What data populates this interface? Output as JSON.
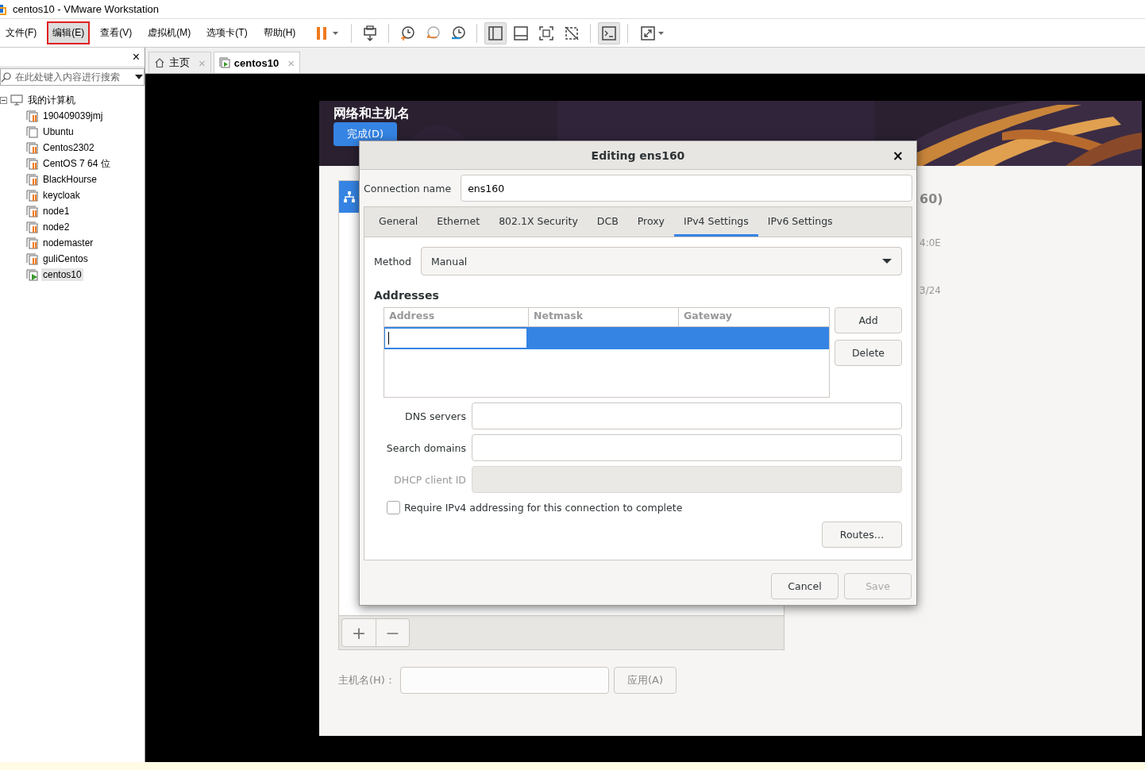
{
  "window": {
    "title": "centos10 - VMware Workstation"
  },
  "menu": [
    {
      "label": "文件(F)",
      "selected": false
    },
    {
      "label": "编辑(E)",
      "selected": true
    },
    {
      "label": "查看(V)",
      "selected": false
    },
    {
      "label": "虚拟机(M)",
      "selected": false
    },
    {
      "label": "选项卡(T)",
      "selected": false
    },
    {
      "label": "帮助(H)",
      "selected": false
    }
  ],
  "toolbar": [
    {
      "kind": "pause",
      "pressed": false
    },
    {
      "kind": "separator"
    },
    {
      "kind": "send-keys",
      "pressed": false
    },
    {
      "kind": "separator"
    },
    {
      "kind": "snapshot-take",
      "pressed": false
    },
    {
      "kind": "snapshot-revert",
      "pressed": false
    },
    {
      "kind": "snapshot-manager",
      "pressed": false
    },
    {
      "kind": "separator"
    },
    {
      "kind": "library-view",
      "pressed": true
    },
    {
      "kind": "thumbnail-bar",
      "pressed": false
    },
    {
      "kind": "full-screen",
      "pressed": false
    },
    {
      "kind": "unity",
      "pressed": false
    },
    {
      "kind": "separator"
    },
    {
      "kind": "console",
      "pressed": true
    },
    {
      "kind": "separator"
    },
    {
      "kind": "stretch",
      "pressed": false
    }
  ],
  "library": {
    "close": "×",
    "search": {
      "placeholder": "在此处键入内容进行搜索"
    },
    "tree": [
      {
        "label": "我的计算机",
        "expanded": true,
        "children": [
          {
            "label": "190409039jmj",
            "suspended": true,
            "running": false,
            "selected": false
          },
          {
            "label": "Ubuntu",
            "suspended": false,
            "running": false,
            "selected": false
          },
          {
            "label": "Centos2302",
            "suspended": true,
            "running": false,
            "selected": false
          },
          {
            "label": "CentOS 7 64 位",
            "suspended": true,
            "running": false,
            "selected": false
          },
          {
            "label": "BlackHourse",
            "suspended": true,
            "running": false,
            "selected": false
          },
          {
            "label": "keycloak",
            "suspended": true,
            "running": false,
            "selected": false
          },
          {
            "label": "node1",
            "suspended": true,
            "running": false,
            "selected": false
          },
          {
            "label": "node2",
            "suspended": true,
            "running": false,
            "selected": false
          },
          {
            "label": "nodemaster",
            "suspended": true,
            "running": false,
            "selected": false
          },
          {
            "label": "guliCentos",
            "suspended": true,
            "running": false,
            "selected": false
          },
          {
            "label": "centos10",
            "suspended": false,
            "running": true,
            "selected": true
          }
        ]
      }
    ]
  },
  "tabs": [
    {
      "label": "主页",
      "kind": "home",
      "selected": false,
      "close": "×"
    },
    {
      "label": "centos10",
      "kind": "vm",
      "selected": true,
      "close": "×"
    }
  ],
  "guest": {
    "title": "网络和主机名",
    "done_button": "完成(D)",
    "device_fragments": [
      "60)",
      "4:0E",
      "3/24"
    ],
    "add_button": "+",
    "remove_button": "−",
    "hostname": {
      "label": "主机名(H)：",
      "apply_button": "应用(A)"
    }
  },
  "dialog": {
    "title": "Editing ens160",
    "close": "×",
    "connection_name": {
      "label": "Connection name",
      "value": "ens160"
    },
    "tabs": [
      {
        "label": "General",
        "selected": false
      },
      {
        "label": "Ethernet",
        "selected": false
      },
      {
        "label": "802.1X Security",
        "selected": false
      },
      {
        "label": "DCB",
        "selected": false
      },
      {
        "label": "Proxy",
        "selected": false
      },
      {
        "label": "IPv4 Settings",
        "selected": true
      },
      {
        "label": "IPv6 Settings",
        "selected": false
      }
    ],
    "method": {
      "label": "Method",
      "value": "Manual"
    },
    "addresses": {
      "heading": "Addresses",
      "columns": [
        "Address",
        "Netmask",
        "Gateway"
      ],
      "rows": [
        {
          "selected": true,
          "editing": true
        }
      ],
      "buttons": [
        {
          "label": "Add",
          "disabled": false
        },
        {
          "label": "Delete",
          "disabled": false
        }
      ]
    },
    "fields": [
      {
        "label": "DNS servers",
        "disabled": false
      },
      {
        "label": "Search domains",
        "disabled": false
      },
      {
        "label": "DHCP client ID",
        "disabled": true
      }
    ],
    "require": {
      "label": "Require IPv4 addressing for this connection to complete",
      "checked": false
    },
    "routes_button": "Routes…",
    "footer": [
      {
        "label": "Cancel",
        "disabled": false
      },
      {
        "label": "Save",
        "disabled": true
      }
    ]
  }
}
